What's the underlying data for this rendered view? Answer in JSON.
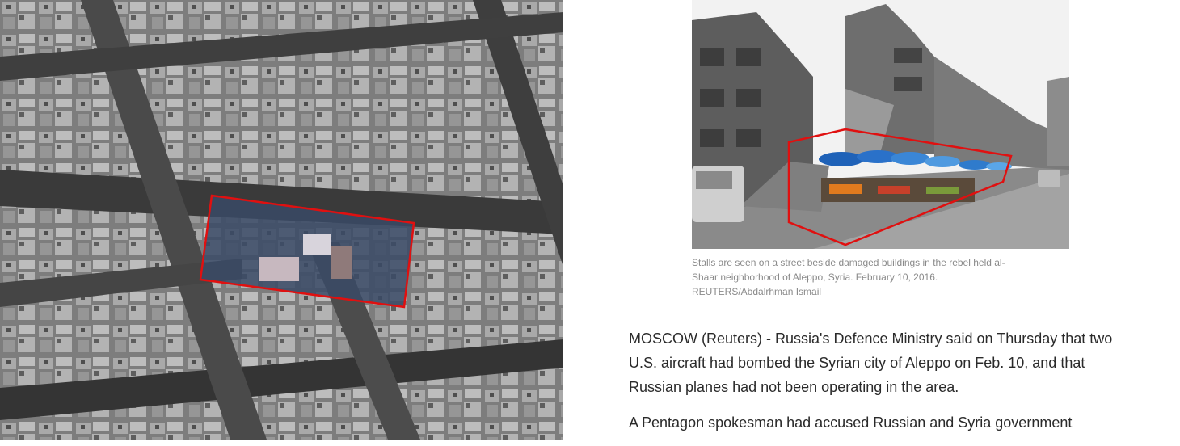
{
  "images": {
    "satellite_icon": "satellite-image-icon",
    "photo_icon": "street-photo-icon",
    "highlight_color": "#e01010"
  },
  "caption": {
    "line1": "Stalls are seen on a street beside damaged buildings in the rebel held al-",
    "line2": "Shaar neighborhood of Aleppo, Syria. February 10, 2016.",
    "credit": "REUTERS/Abdalrhman Ismail"
  },
  "article": {
    "p1": "MOSCOW (Reuters) - Russia's Defence Ministry said on Thursday that two U.S. aircraft had bombed the Syrian city of Aleppo on Feb. 10, and that Russian planes had not been operating in the area.",
    "p2": "A Pentagon spokesman had accused Russian and Syria government"
  }
}
